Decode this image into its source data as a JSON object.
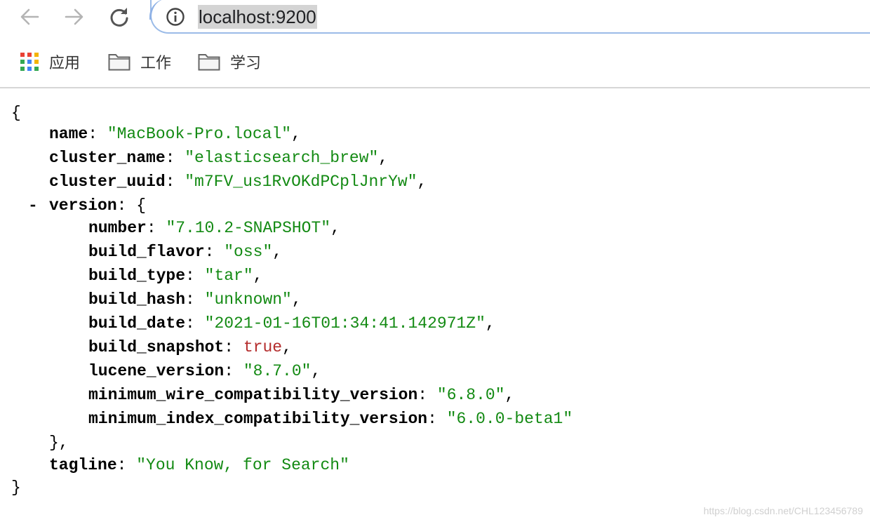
{
  "browser": {
    "url": "localhost:9200",
    "icons": {
      "back": "arrow-left-icon",
      "forward": "arrow-right-icon",
      "reload": "reload-icon",
      "info": "info-icon",
      "apps": "apps-grid-icon",
      "folder": "folder-icon"
    }
  },
  "bookmarks": [
    {
      "label": "应用"
    },
    {
      "label": "工作"
    },
    {
      "label": "学习"
    }
  ],
  "json": {
    "open": "{",
    "close": "}",
    "collapse_symbol": "-",
    "name_key": "name",
    "name_val": "\"MacBook-Pro.local\"",
    "cluster_name_key": "cluster_name",
    "cluster_name_val": "\"elasticsearch_brew\"",
    "cluster_uuid_key": "cluster_uuid",
    "cluster_uuid_val": "\"m7FV_us1RvOKdPCplJnrYw\"",
    "version_key": "version",
    "version": {
      "number_key": "number",
      "number_val": "\"7.10.2-SNAPSHOT\"",
      "build_flavor_key": "build_flavor",
      "build_flavor_val": "\"oss\"",
      "build_type_key": "build_type",
      "build_type_val": "\"tar\"",
      "build_hash_key": "build_hash",
      "build_hash_val": "\"unknown\"",
      "build_date_key": "build_date",
      "build_date_val": "\"2021-01-16T01:34:41.142971Z\"",
      "build_snapshot_key": "build_snapshot",
      "build_snapshot_val": "true",
      "lucene_version_key": "lucene_version",
      "lucene_version_val": "\"8.7.0\"",
      "min_wire_key": "minimum_wire_compatibility_version",
      "min_wire_val": "\"6.8.0\"",
      "min_index_key": "minimum_index_compatibility_version",
      "min_index_val": "\"6.0.0-beta1\"",
      "close": "},"
    },
    "tagline_key": "tagline",
    "tagline_val": "\"You Know, for Search\""
  },
  "watermark": "https://blog.csdn.net/CHL123456789",
  "colors": {
    "string": "#138a13",
    "boolean": "#b42c2c",
    "omnibox_focus": "#8fb2e6"
  }
}
